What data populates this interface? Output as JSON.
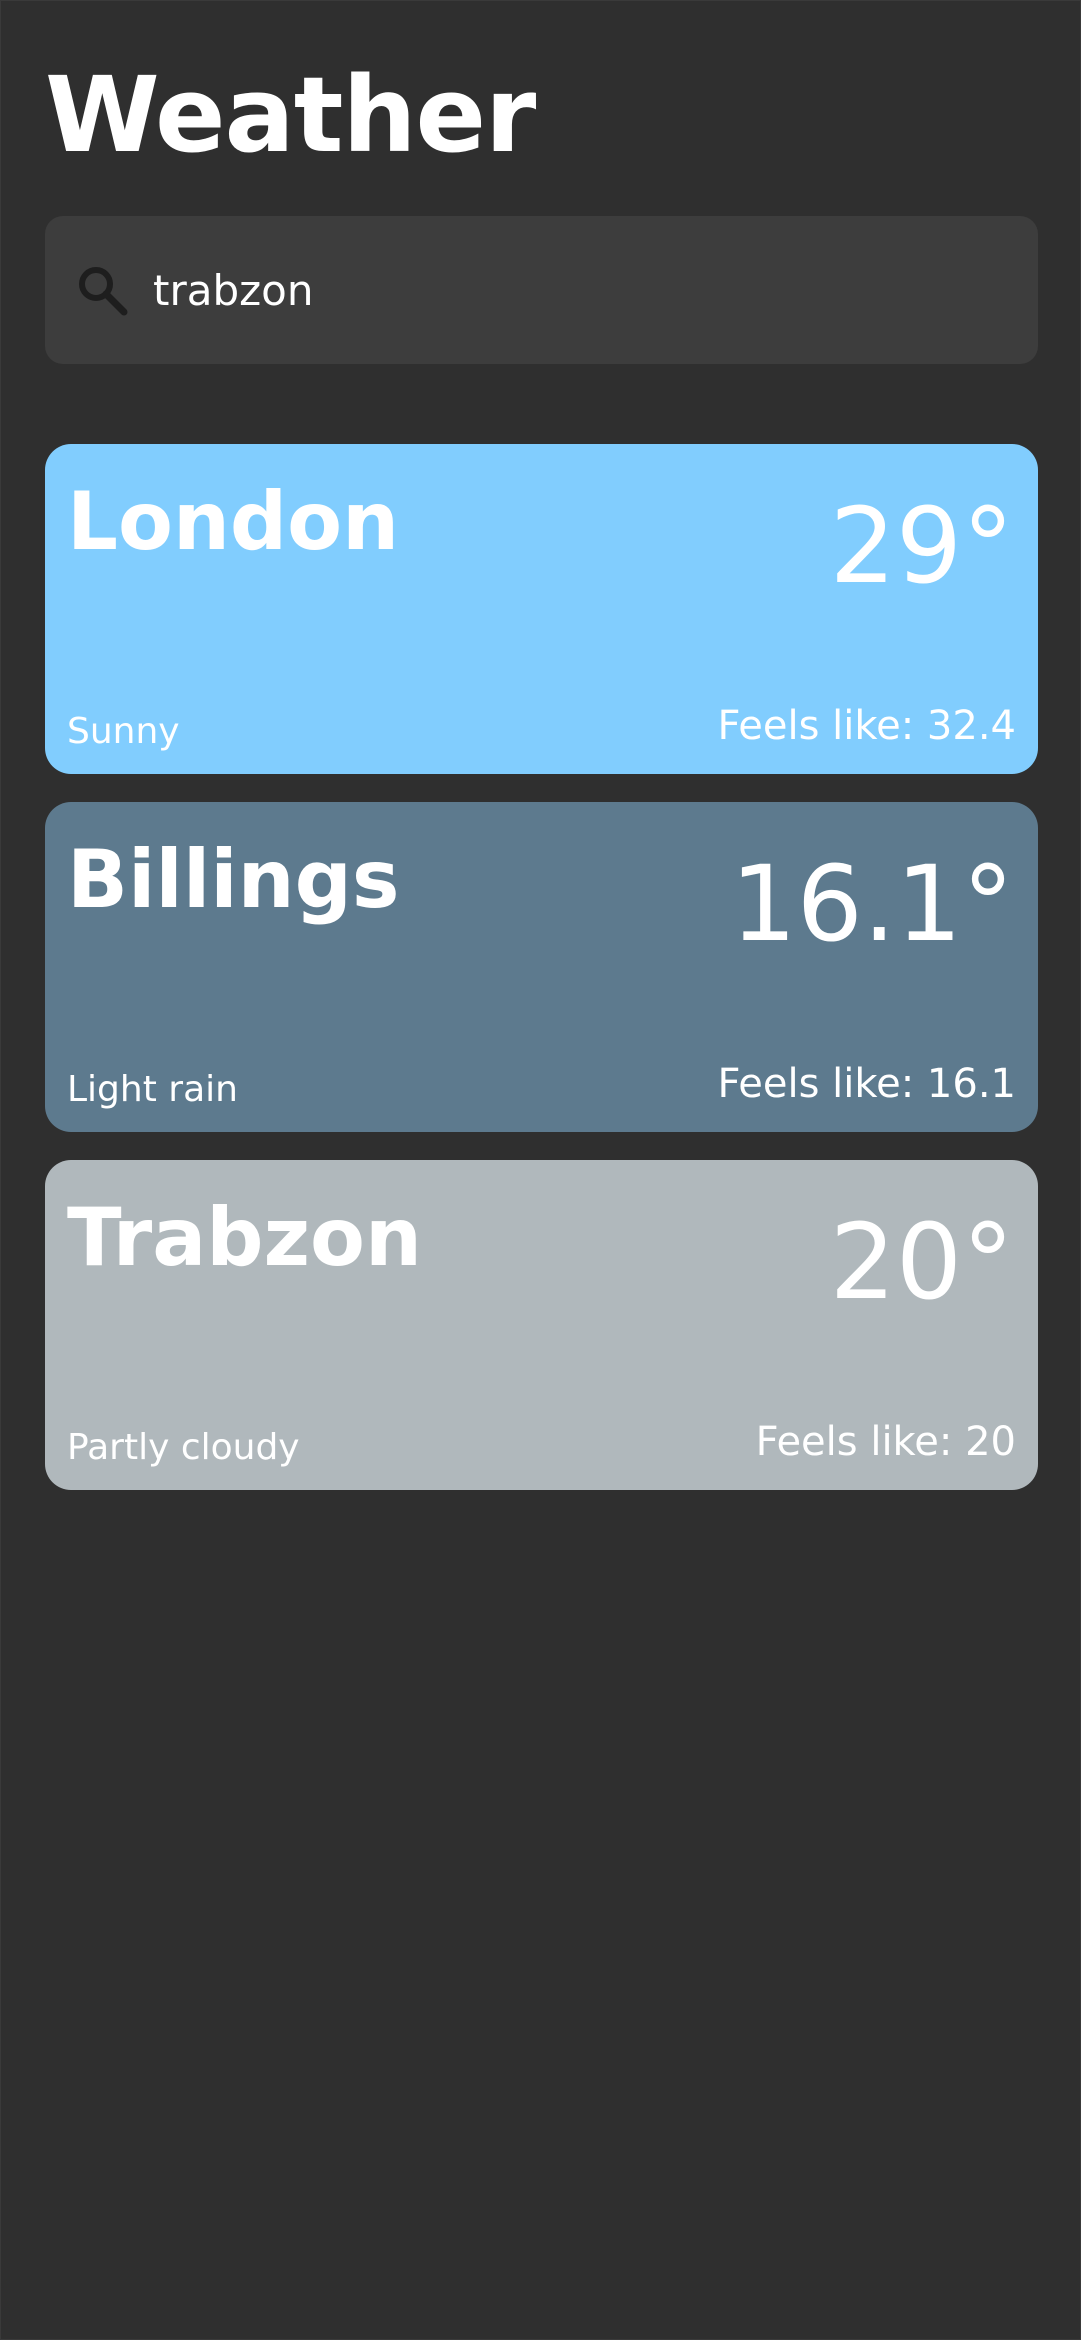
{
  "header": {
    "title": "Weather"
  },
  "search": {
    "icon": "search-icon",
    "value": "trabzon"
  },
  "colors": {
    "background": "#2f2f2f",
    "search_bg": "#3d3d3d",
    "card_sunny": "#81cdfe",
    "card_rain": "#5d7a8e",
    "card_cloudy": "#b0b8bc"
  },
  "cards": [
    {
      "city": "London",
      "temp": "29°",
      "condition": "Sunny",
      "feels": "Feels like: 32.4",
      "color": "#81cdfe"
    },
    {
      "city": "Billings",
      "temp": "16.1°",
      "condition": "Light rain",
      "feels": "Feels like: 16.1",
      "color": "#5d7a8e"
    },
    {
      "city": "Trabzon",
      "temp": "20°",
      "condition": "Partly cloudy",
      "feels": "Feels like: 20",
      "color": "#b0b8bc"
    }
  ]
}
